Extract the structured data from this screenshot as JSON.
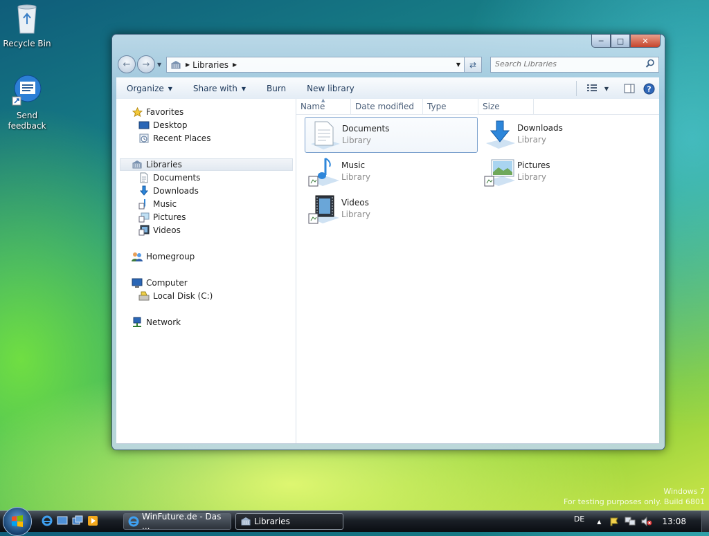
{
  "desktop": {
    "icons": [
      {
        "label": "Recycle Bin",
        "icon": "recycle-bin-icon"
      },
      {
        "label": "Send feedback",
        "icon": "send-feedback-icon"
      }
    ],
    "watermark": {
      "line1": "Windows 7",
      "line2": "For testing purposes only. Build 6801"
    }
  },
  "window": {
    "buttons": {
      "minimize": "minimize-icon",
      "maximize": "maximize-icon",
      "close": "close-icon"
    },
    "address": {
      "crumb": "Libraries"
    },
    "search": {
      "placeholder": "Search Libraries"
    },
    "toolbar": {
      "organize": "Organize",
      "share_with": "Share with",
      "burn": "Burn",
      "new_library": "New library"
    },
    "nav": {
      "favorites": "Favorites",
      "favorites_items": [
        "Desktop",
        "Recent Places"
      ],
      "libraries": "Libraries",
      "libraries_items": [
        "Documents",
        "Downloads",
        "Music",
        "Pictures",
        "Videos"
      ],
      "homegroup": "Homegroup",
      "computer": "Computer",
      "computer_items": [
        "Local Disk (C:)"
      ],
      "network": "Network"
    },
    "columns": [
      "Name",
      "Date modified",
      "Type",
      "Size"
    ],
    "items": [
      {
        "name": "Documents",
        "type": "Library",
        "icon": "documents-library-icon"
      },
      {
        "name": "Downloads",
        "type": "Library",
        "icon": "downloads-library-icon"
      },
      {
        "name": "Music",
        "type": "Library",
        "icon": "music-library-icon"
      },
      {
        "name": "Pictures",
        "type": "Library",
        "icon": "pictures-library-icon"
      },
      {
        "name": "Videos",
        "type": "Library",
        "icon": "videos-library-icon"
      }
    ]
  },
  "taskbar": {
    "tasks": [
      {
        "label": "WinFuture.de - Das ...",
        "icon": "ie-icon"
      },
      {
        "label": "Libraries",
        "icon": "library-icon"
      }
    ],
    "language": "DE",
    "time": "13:08"
  }
}
